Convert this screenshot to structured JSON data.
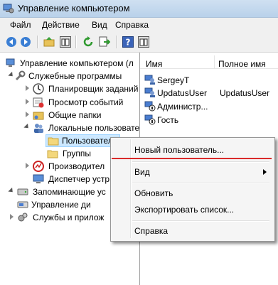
{
  "window": {
    "title": "Управление компьютером"
  },
  "menu": {
    "file": "Файл",
    "action": "Действие",
    "view": "Вид",
    "help": "Справка"
  },
  "tree": {
    "root": "Управление компьютером (л",
    "utilities": "Служебные программы",
    "scheduler": "Планировщик заданий",
    "eventviewer": "Просмотр событий",
    "sharedfolders": "Общие папки",
    "localusers": "Локальные пользовате",
    "users": "Пользователи",
    "groups": "Группы",
    "performance": "Производител",
    "devicemgr": "Диспетчер устр",
    "storage": "Запоминающие ус",
    "diskmgmt": "Управление ди",
    "services": "Службы и прилож"
  },
  "list": {
    "col_name": "Имя",
    "col_fullname": "Полное имя",
    "rows": [
      {
        "name": "SergeyT",
        "fullname": ""
      },
      {
        "name": "UpdatusUser",
        "fullname": "UpdatusUser"
      },
      {
        "name": "Администр...",
        "fullname": ""
      },
      {
        "name": "Гость",
        "fullname": ""
      }
    ]
  },
  "context_menu": {
    "new_user": "Новый пользователь...",
    "view": "Вид",
    "refresh": "Обновить",
    "export": "Экспортировать список...",
    "help": "Справка"
  },
  "colors": {
    "highlight": "#cce8ff",
    "redline": "#d92a2a"
  }
}
